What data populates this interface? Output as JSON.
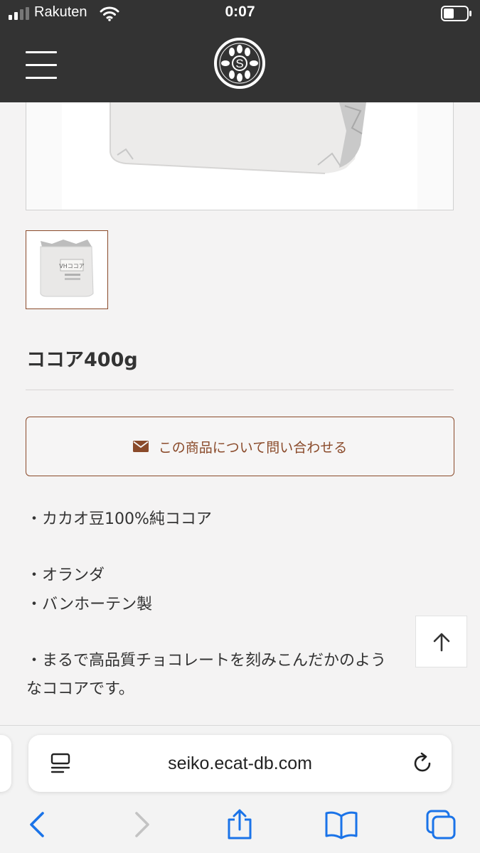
{
  "status_bar": {
    "carrier": "Rakuten",
    "time": "0:07",
    "battery_level": 0.45
  },
  "header": {
    "logo_letter": "S"
  },
  "product": {
    "name": "ココア400g",
    "thumbnail_label": "VHココア",
    "contact_label": "この商品について問い合わせる",
    "description": [
      "・カカオ豆100%純ココア",
      "・オランダ",
      "・バンホーテン製",
      "・まるで高品質チョコレートを刻みこんだかのよう",
      "なココアです。"
    ]
  },
  "browser": {
    "url": "seiko.ecat-db.com"
  },
  "colors": {
    "header_bg": "#333333",
    "accent": "#8a4a2a",
    "ios_blue": "#1a73e8"
  },
  "icons": [
    "signal-icon",
    "wifi-icon",
    "battery-icon",
    "hamburger-menu-icon",
    "logo-icon",
    "mail-icon",
    "arrow-up-icon",
    "reader-icon",
    "reload-icon",
    "back-icon",
    "forward-icon",
    "share-icon",
    "bookmarks-icon",
    "tabs-icon"
  ]
}
